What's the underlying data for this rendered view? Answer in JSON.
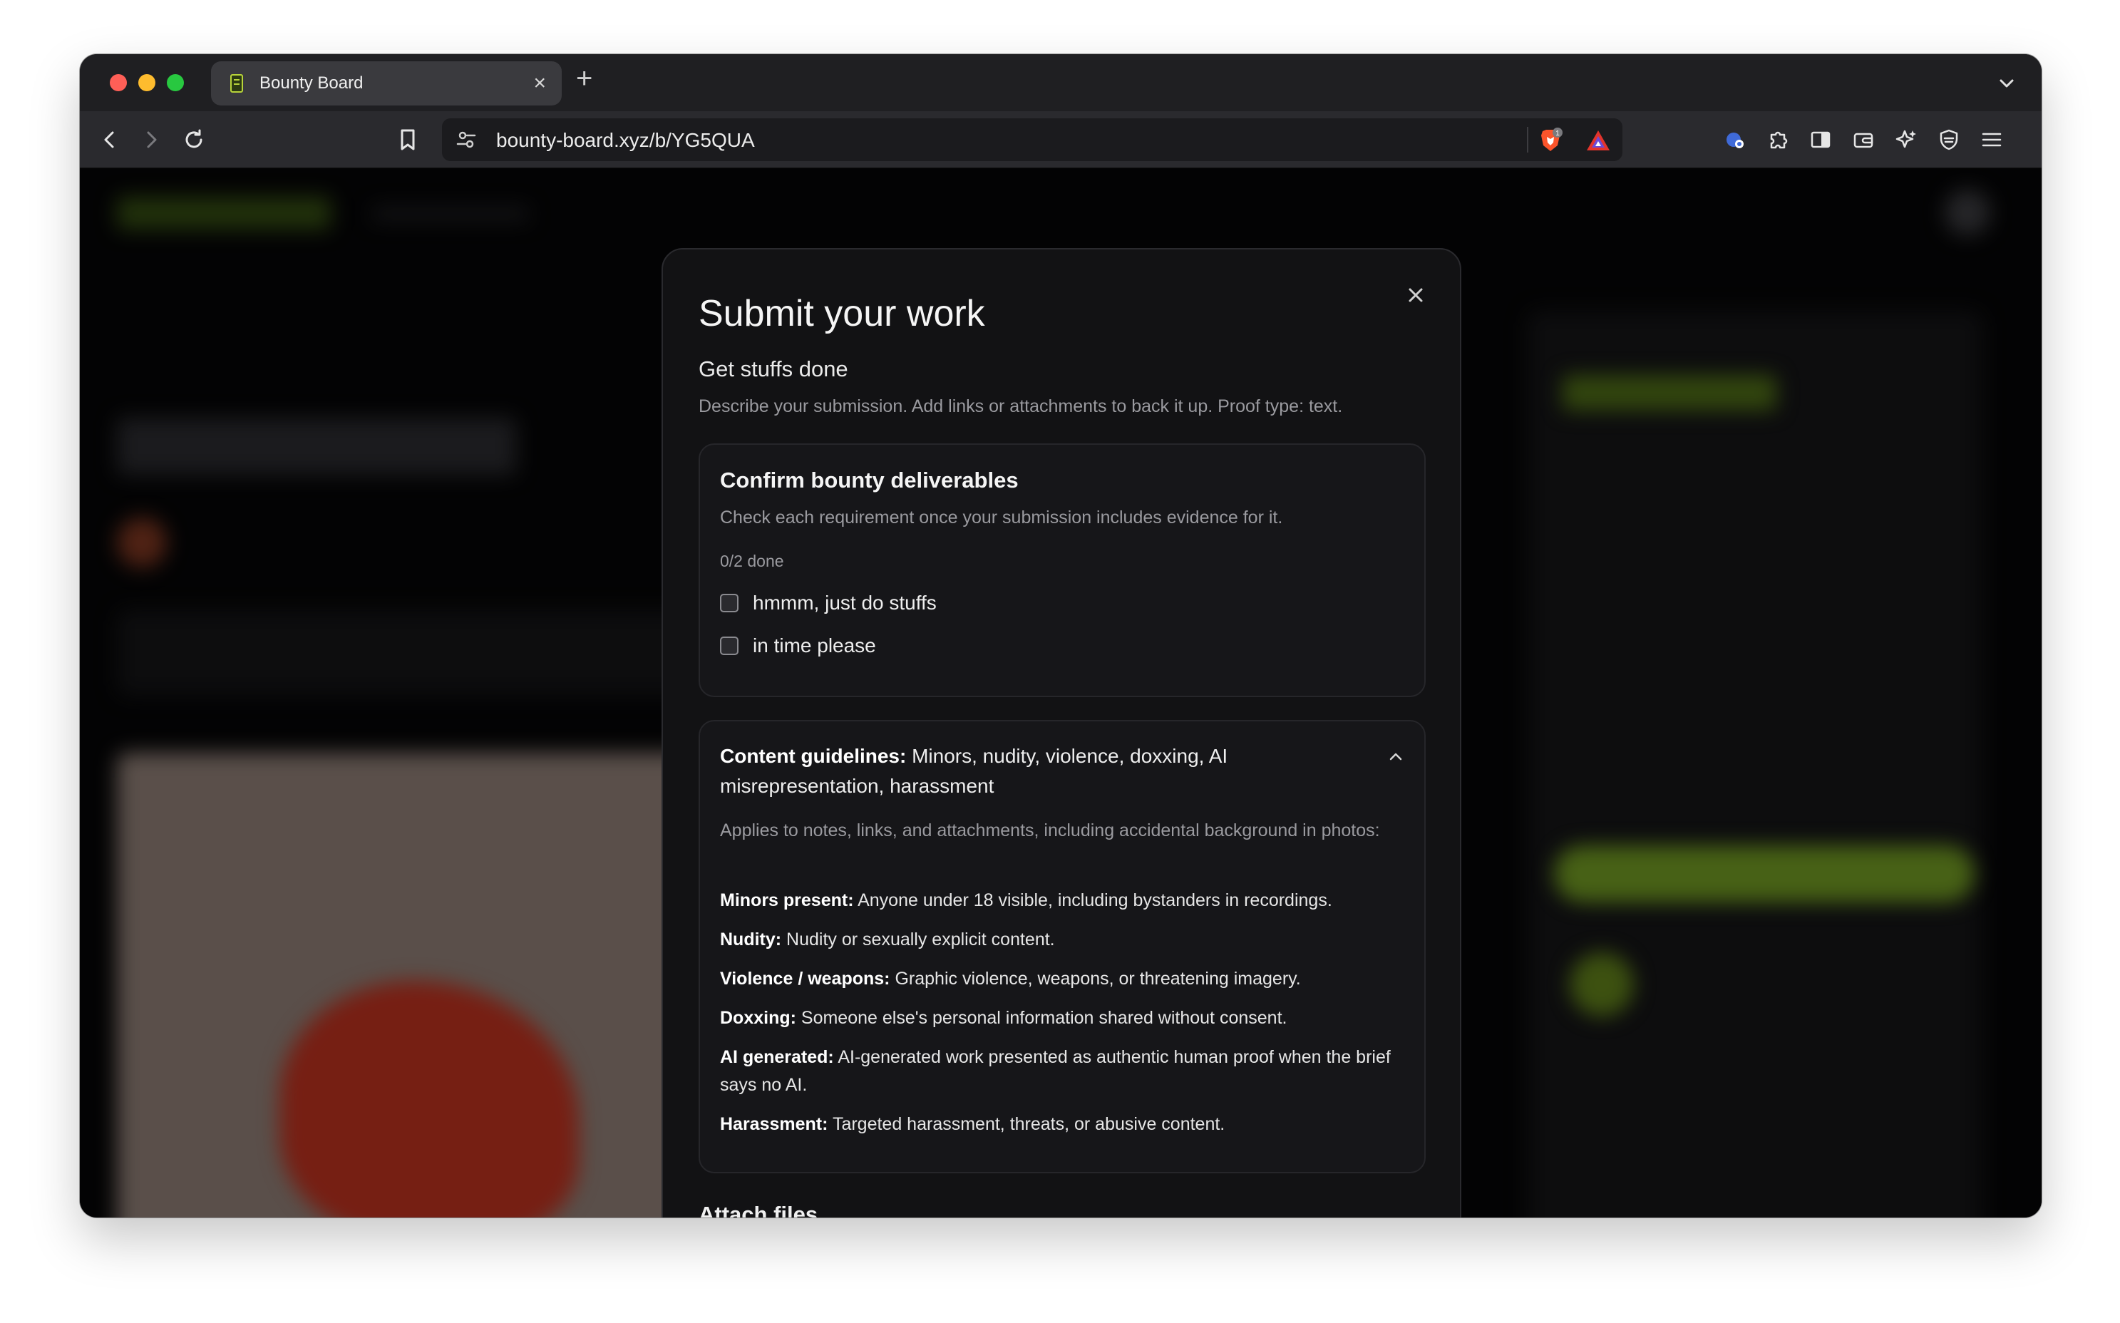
{
  "browser": {
    "tab_title": "Bounty Board",
    "tab_close": "×",
    "new_tab": "+",
    "url": "bounty-board.xyz/b/YG5QUA",
    "shield_badge": "1"
  },
  "modal": {
    "title": "Submit your work",
    "subtitle": "Get stuffs done",
    "description": "Describe your submission. Add links or attachments to back it up. Proof type: text.",
    "deliverables": {
      "title": "Confirm bounty deliverables",
      "description": "Check each requirement once your submission includes evidence for it.",
      "progress": "0/2 done",
      "items": [
        {
          "label": "hmmm, just do stuffs",
          "checked": false
        },
        {
          "label": "in time please",
          "checked": false
        }
      ]
    },
    "guidelines": {
      "heading_bold": "Content guidelines:",
      "heading_text": " Minors, nudity, violence, doxxing, AI misrepresentation, harassment",
      "applies": "Applies to notes, links, and attachments, including accidental background in photos:",
      "rules": [
        {
          "name": "Minors present:",
          "text": " Anyone under 18 visible, including bystanders in recordings."
        },
        {
          "name": "Nudity:",
          "text": " Nudity or sexually explicit content."
        },
        {
          "name": "Violence / weapons:",
          "text": " Graphic violence, weapons, or threatening imagery."
        },
        {
          "name": "Doxxing:",
          "text": " Someone else's personal information shared without consent."
        },
        {
          "name": "AI generated:",
          "text": " AI-generated work presented as authentic human proof when the brief says no AI."
        },
        {
          "name": "Harassment:",
          "text": " Targeted harassment, threats, or abusive content."
        }
      ]
    },
    "attach_title": "Attach files"
  },
  "colors": {
    "accent_green": "#7fae1f",
    "modal_bg": "#121214"
  }
}
